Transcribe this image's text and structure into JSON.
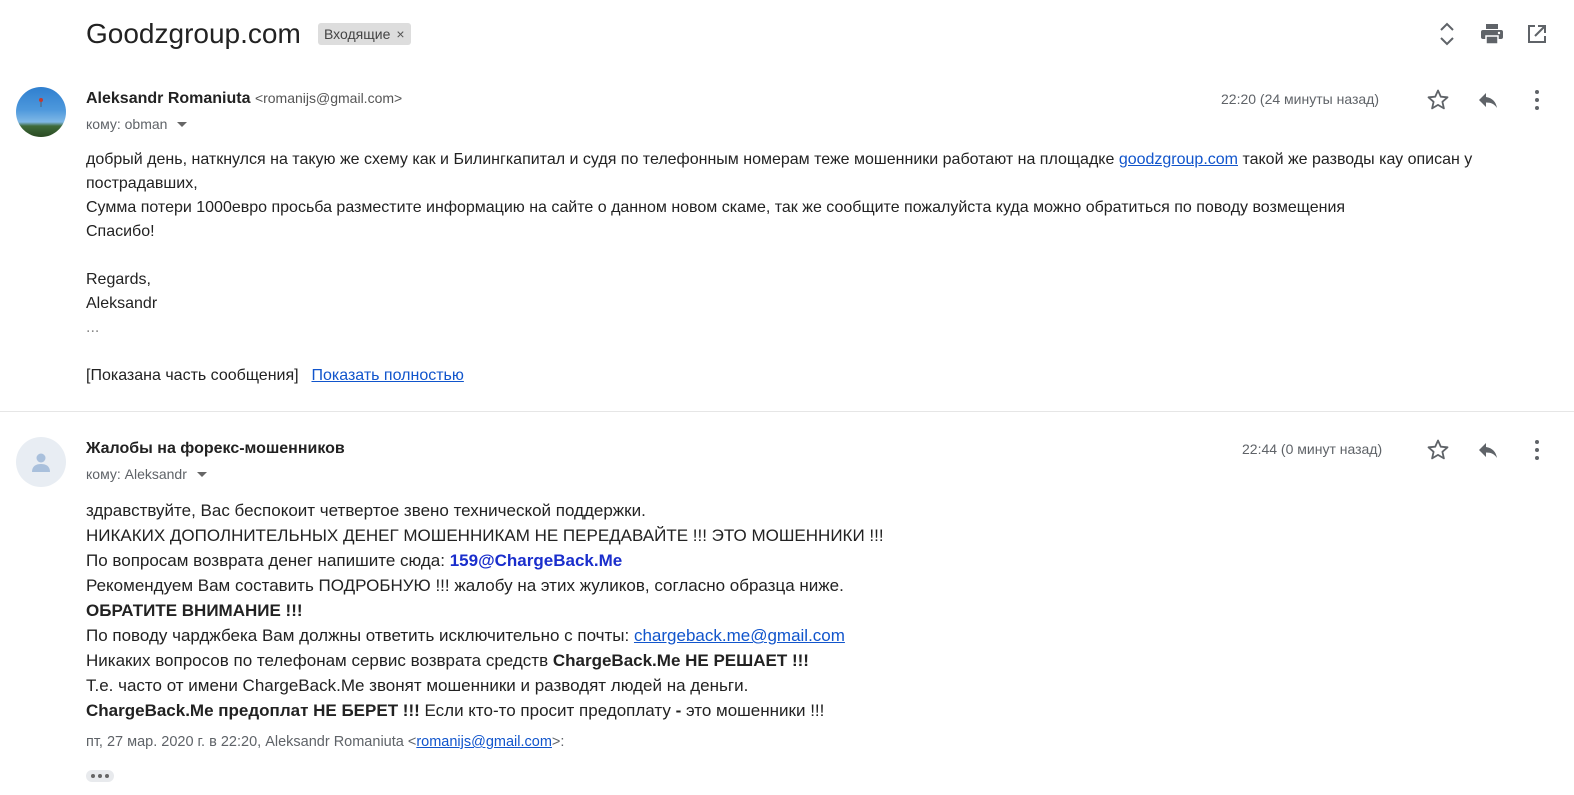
{
  "thread": {
    "subject": "Goodzgroup.com",
    "label": "Входящие",
    "label_remove": "×"
  },
  "icons": {
    "expand": "expand-all-icon",
    "print": "print-icon",
    "popout": "open-in-new-window-icon",
    "star": "star-icon",
    "reply": "reply-icon",
    "more": "more-vertical-icon"
  },
  "messages": [
    {
      "sender_name": "Aleksandr Romaniuta",
      "sender_email": "<romanijs@gmail.com>",
      "to": "кому: obman",
      "time": "22:20 (24 минуты назад)",
      "body": {
        "line1_before": "добрый день, наткнулся на такую же схему как и Билингкапитал и судя по телефонным номерам теже мошенники работают на площадке ",
        "line1_link": "goodzgroup.com",
        "line1_after": " такой же разводы кау описан у",
        "line2": "пострадавших,",
        "line3": "Сумма потери 1000евро просьба разместите информацию  на сайте о данном новом скаме, так же сообщите пожалуйста куда можно обратиться по поводу возмещения",
        "line4": "Спасибо!",
        "line5": "Regards,",
        "line6": "Aleksandr",
        "line7": "...",
        "clipped_text": "[Показана часть сообщения]",
        "show_full": "Показать полностью"
      }
    },
    {
      "sender_name": "Жалобы на форекс-мошенников",
      "to": "кому: Aleksandr",
      "time": "22:44 (0 минут назад)",
      "body": {
        "l1": "здравствуйте, Вас беспокоит четвертое звено технической поддержки.",
        "l2": "НИКАКИХ ДОПОЛНИТЕЛЬНЫХ ДЕНЕГ МОШЕННИКАМ НЕ ПЕРЕДАВАЙТЕ !!! ЭТО МОШЕННИКИ !!!",
        "l3_before": "По вопросам возврата денег напишите сюда: ",
        "l3_email": "159@ChargeBack.Me",
        "l4": "Рекомендуем Вам составить ПОДРОБНУЮ !!! жалобу на этих жуликов, согласно образца ниже.",
        "l5": "ОБРАТИТЕ ВНИМАНИЕ !!!",
        "l6_before": "По поводу чарджбека Вам должны ответить исключительно с почты: ",
        "l6_link": "chargeback.me@gmail.com",
        "l7_before": "Никаких вопросов по телефонам сервис возврата средств ",
        "l7_bold": "ChargeBack.Me НЕ РЕШАЕТ !!!",
        "l8": "Т.е. часто от имени ChargeBack.Me звонят мошенники и разводят людей на деньги.",
        "l9_bold": "ChargeBack.Me предоплат НЕ БЕРЕТ !!!",
        "l9_mid": " Если кто-то просит предоплату ",
        "l9_dash": "-",
        "l9_after": " это мошенники !!!",
        "quote_before": "пт, 27 мар. 2020 г. в 22:20, Aleksandr Romaniuta <",
        "quote_email": "romanijs@gmail.com",
        "quote_after": ">:"
      }
    }
  ]
}
